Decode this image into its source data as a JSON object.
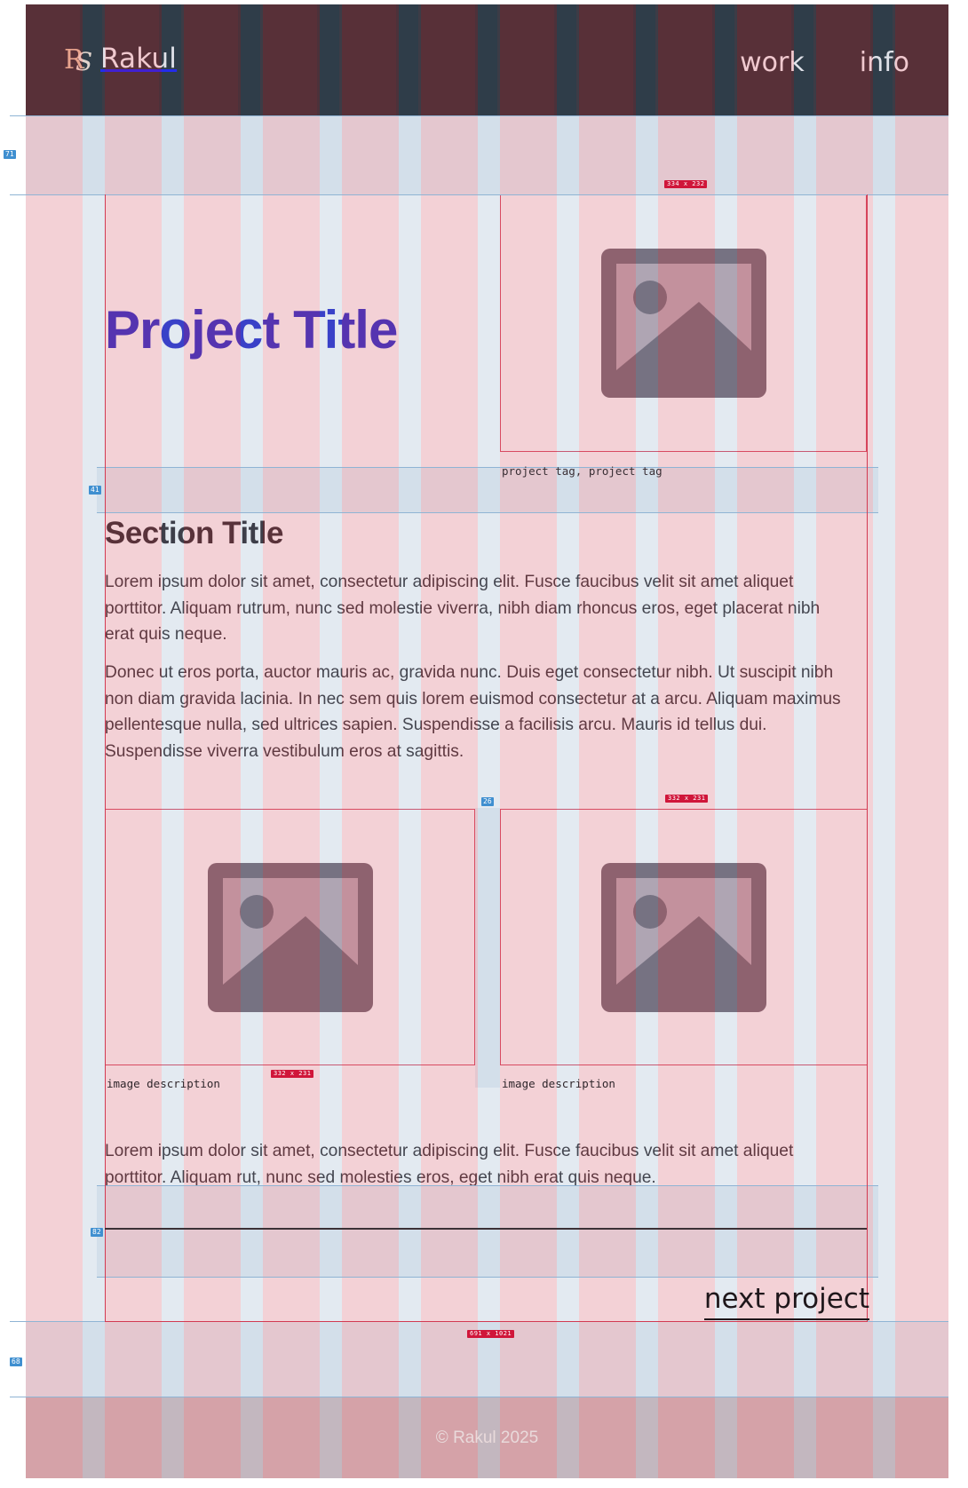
{
  "header": {
    "logo_text": "Rakul",
    "nav": [
      {
        "label": "work"
      },
      {
        "label": "info"
      }
    ]
  },
  "project": {
    "title": "Project Title",
    "tags": "project tag, project tag",
    "section_title": "Section Title",
    "paragraphs": [
      "Lorem ipsum dolor sit amet, consectetur adipiscing elit. Fusce faucibus velit sit amet aliquet porttitor. Aliquam rutrum, nunc sed molestie viverra, nibh diam rhoncus eros, eget placerat nibh erat quis neque.",
      "Donec ut eros porta, auctor mauris ac, gravida nunc. Duis eget consectetur nibh. Ut suscipit nibh non diam gravida lacinia. In nec sem quis lorem euismod consectetur at a arcu. Aliquam maximus pellentesque nulla, sed ultrices sapien. Suspendisse a facilisis arcu. Mauris id tellus dui. Suspendisse viverra vestibulum eros at sagittis."
    ],
    "gallery": [
      {
        "caption": "image description"
      },
      {
        "caption": "image description"
      }
    ],
    "closing_paragraph": "Lorem ipsum dolor sit amet, consectetur adipiscing elit. Fusce faucibus velit sit amet aliquet porttitor. Aliquam rut, nunc sed molesties eros, eget nibh erat quis neque.",
    "next_label": "next project"
  },
  "overlay": {
    "spacing_badges": [
      "71",
      "41",
      "26",
      "82",
      "68"
    ],
    "dimension_badges": [
      "334 x 232",
      "332 x 231",
      "332 x 231",
      "691 x 1021"
    ]
  },
  "footer": {
    "copyright": "© Rakul 2025"
  },
  "colors": {
    "header_bg": "#211519",
    "title_accent": "#1d1bbf",
    "footer_bg": "#cdb3b4",
    "overlay_column": "#ea7887",
    "overlay_gutter": "#a0c8e6",
    "measure_line": "#d23a52",
    "spacing_badge": "#3f8fd0"
  },
  "icons": [
    "image-placeholder-icon",
    "rakul-logo-icon"
  ]
}
